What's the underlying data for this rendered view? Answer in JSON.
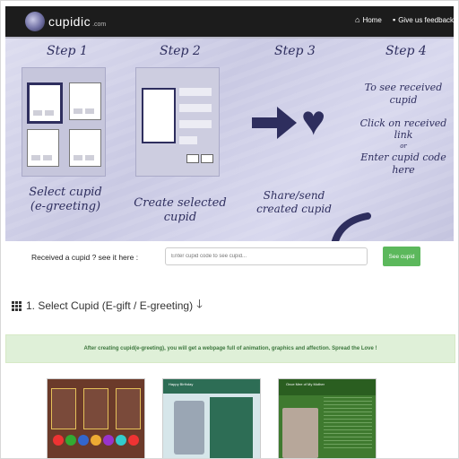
{
  "navbar": {
    "brand": "cupidic",
    "brand_suffix": ".com",
    "links": [
      {
        "label": "Home",
        "icon": "home-icon"
      },
      {
        "label": "Give us feedback",
        "icon": "comment-icon"
      }
    ]
  },
  "hero": {
    "steps": [
      {
        "title": "Step 1",
        "text": "Select cupid (e-greeting)"
      },
      {
        "title": "Step 2",
        "text": "Create selected cupid"
      },
      {
        "title": "Step 3",
        "text": "Share/send created cupid"
      },
      {
        "title": "Step 4",
        "text_lines": [
          "To see received cupid",
          "Click on received link",
          "or",
          "Enter cupid code here"
        ]
      }
    ]
  },
  "receive": {
    "prompt": "Received a cupid ? see it here :",
    "placeholder": "Enter cupid code to see cupid...",
    "button": "See cupid"
  },
  "section": {
    "title": "1. Select Cupid (E-gift / E-greeting)"
  },
  "info": "After creating cupid(e-greeting), you will get a webpage full of animation, graphics and affection. Spread the Love !",
  "thumbnails": [
    {
      "name": "puzzle-greeting"
    },
    {
      "name": "photo-greeting",
      "header": "Happy Birthday"
    },
    {
      "name": "poem-greeting",
      "header": "Once Mee of My Mother"
    }
  ]
}
